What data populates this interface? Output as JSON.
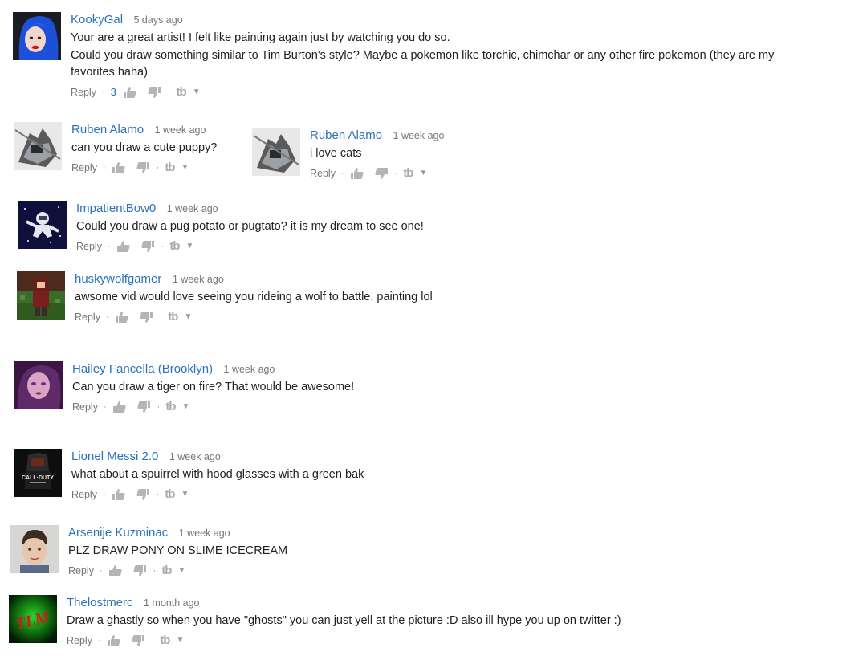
{
  "comments": [
    {
      "author": "KookyGal",
      "time": "5 days ago",
      "lines": [
        "Your are a great artist! I felt like painting again just by watching you do so.",
        "Could you draw something similar to Tim Burton's style? Maybe a pokemon like torchic, chimchar or any other fire pokemon (they are my",
        "favorites haha)"
      ],
      "likes": "3",
      "reply_label": "Reply",
      "avatar": "avatar-blue-hair-woman"
    },
    {
      "author": "Ruben Alamo",
      "time": "1 week ago",
      "lines": [
        "can you draw a cute puppy?"
      ],
      "reply_label": "Reply",
      "avatar": "avatar-robot-mech"
    },
    {
      "author": "Ruben Alamo",
      "time": "1 week ago",
      "lines": [
        "i love cats"
      ],
      "reply_label": "Reply",
      "avatar": "avatar-robot-mech"
    },
    {
      "author": "ImpatientBow0",
      "time": "1 week ago",
      "lines": [
        "Could you draw a pug potato or pugtato? it is my dream to see one!"
      ],
      "reply_label": "Reply",
      "avatar": "avatar-astronaut-space"
    },
    {
      "author": "huskywolfgamer",
      "time": "1 week ago",
      "lines": [
        "awsome vid would love seeing you rideing a wolf to battle. painting lol"
      ],
      "reply_label": "Reply",
      "avatar": "avatar-minecraft-character"
    },
    {
      "author": "Hailey Fancella (Brooklyn)",
      "time": "1 week ago",
      "lines": [
        "Can you draw a tiger on fire? That would be awesome!"
      ],
      "reply_label": "Reply",
      "avatar": "avatar-purple-portrait"
    },
    {
      "author": "Lionel Messi 2.0",
      "time": "1 week ago",
      "lines": [
        "what about a spuirrel with hood glasses with a green bak"
      ],
      "reply_label": "Reply",
      "avatar": "avatar-call-of-duty",
      "avatar_text": "CALL·DUTY"
    },
    {
      "author": "Arsenije Kuzminac",
      "time": "1 week ago",
      "lines": [
        "PLZ DRAW PONY ON SLIME ICECREAM"
      ],
      "reply_label": "Reply",
      "avatar": "avatar-child-photo"
    },
    {
      "author": "Thelostmerc",
      "time": "1 month ago",
      "lines": [
        "Draw a ghastly so when you have \"ghosts\" you can just yell at the picture :D also ill hype you up on twitter :)"
      ],
      "reply_label": "Reply",
      "avatar": "avatar-tlm-logo",
      "avatar_text": "TLM"
    }
  ],
  "icons": {
    "thumbs_up": "thumbs-up-icon",
    "thumbs_down": "thumbs-down-icon",
    "tb": "tb",
    "caret": "▼"
  },
  "colors": {
    "author": "#2a73bc",
    "text": "#222222",
    "meta": "#767676",
    "icon": "#b5b5b5"
  }
}
